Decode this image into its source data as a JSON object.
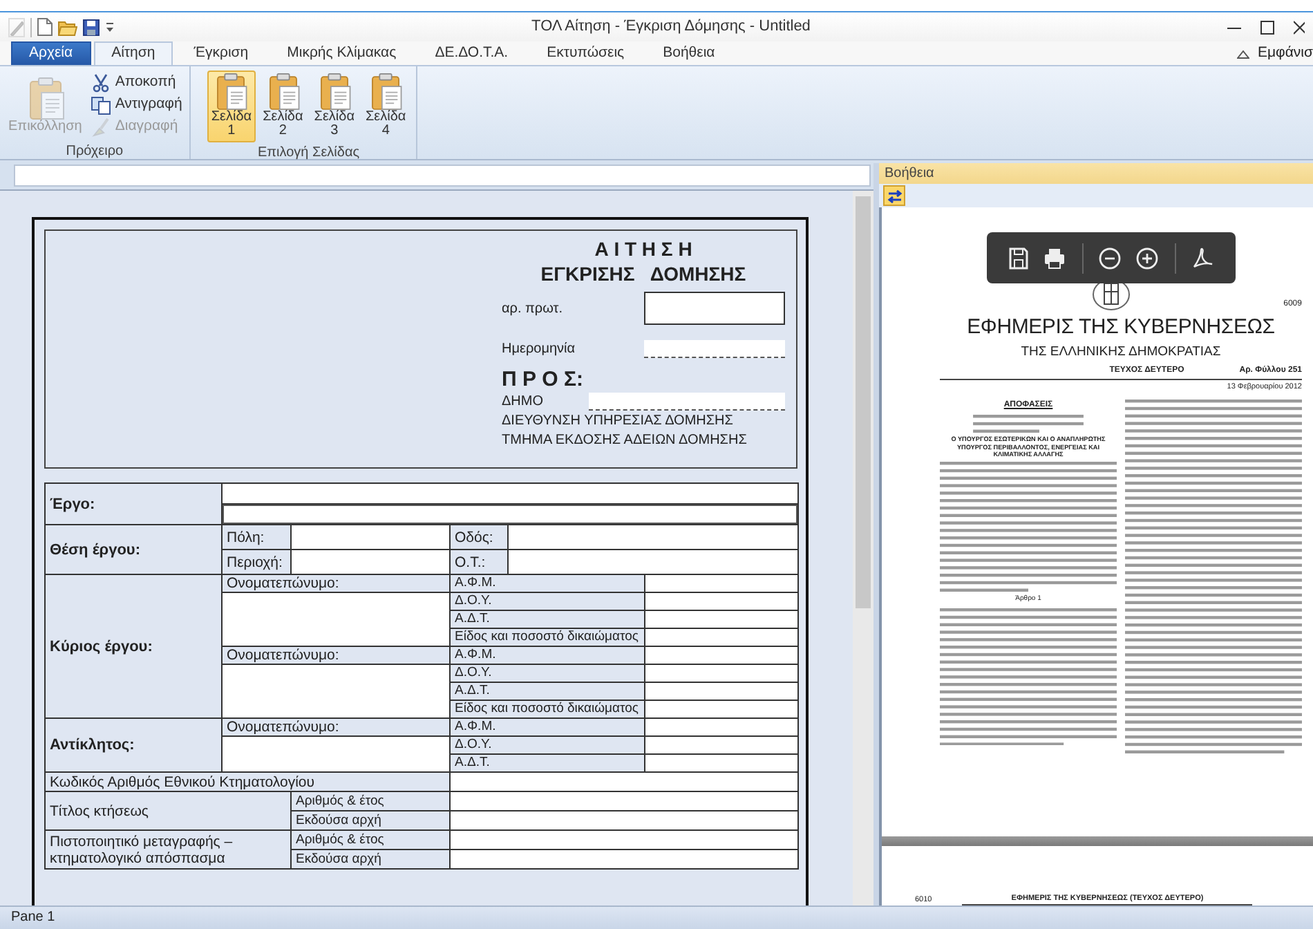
{
  "window": {
    "title": "ΤΟΛ Αίτηση - Έγκριση Δόμησης - Untitled"
  },
  "menu_tabs": [
    {
      "label": "Αρχεία",
      "kind": "file",
      "selected": false
    },
    {
      "label": "Αίτηση",
      "kind": "tab",
      "selected": true
    },
    {
      "label": "Έγκριση",
      "kind": "tab",
      "selected": false
    },
    {
      "label": "Μικρής Κλίμακας",
      "kind": "tab",
      "selected": false
    },
    {
      "label": "ΔΕ.ΔΟ.Τ.Α.",
      "kind": "tab",
      "selected": false
    },
    {
      "label": "Εκτυπώσεις",
      "kind": "tab",
      "selected": false
    },
    {
      "label": "Βοήθεια",
      "kind": "tab",
      "selected": false
    }
  ],
  "view_menu": {
    "label": "Εμφάνισ"
  },
  "ribbon_groups": [
    {
      "kind": "clipboard",
      "label": "Πρόχειρο",
      "large": {
        "label": "Επικόλληση",
        "disabled": true
      },
      "small": [
        {
          "kind": "cut",
          "label": "Αποκοπή",
          "disabled": false
        },
        {
          "kind": "copy",
          "label": "Αντιγραφή",
          "disabled": false
        },
        {
          "kind": "delete",
          "label": "Διαγραφή",
          "disabled": true
        }
      ]
    },
    {
      "kind": "pages",
      "label": "Επιλογή Σελίδας",
      "buttons": [
        {
          "label": "Σελίδα",
          "number": "1",
          "selected": true
        },
        {
          "label": "Σελίδα",
          "number": "2",
          "selected": false
        },
        {
          "label": "Σελίδα",
          "number": "3",
          "selected": false
        },
        {
          "label": "Σελίδα",
          "number": "4",
          "selected": false
        }
      ]
    }
  ],
  "form": {
    "header": {
      "title": "Α Ι Τ Η Σ Η",
      "subtitle": "ΕΓΚΡΙΣΗΣ   ΔΟΜΗΣΗΣ",
      "protocol_label": "αρ. πρωτ.",
      "date_label": "Ημερομηνία",
      "to_heading": "Π Ρ Ο Σ:",
      "municipality_label": "ΔΗΜΟ",
      "lines": [
        "ΔΙΕΥΘΥΝΣΗ ΥΠΗΡΕΣΙΑΣ ΔΟΜΗΣΗΣ",
        "ΤΜΗΜΑ ΕΚΔΟΣΗΣ ΑΔΕΙΩΝ ΔΟΜΗΣΗΣ"
      ]
    },
    "sections": [
      {
        "kind": "project",
        "label": "Έργο:"
      },
      {
        "kind": "location",
        "label": "Θέση έργου:",
        "fields": [
          "Πόλη:",
          "Οδός:",
          "Περιοχή:",
          "Ο.Τ.:"
        ]
      },
      {
        "kind": "persons",
        "label": "Κύριος έργου:",
        "persons": [
          {
            "name_label": "Ονοματεπώνυμο:",
            "fields": [
              "Α.Φ.Μ.",
              "Δ.Ο.Υ.",
              "Α.Δ.Τ.",
              "Είδος και ποσοστό δικαιώματος"
            ]
          },
          {
            "name_label": "Ονοματεπώνυμο:",
            "fields": [
              "Α.Φ.Μ.",
              "Δ.Ο.Υ.",
              "Α.Δ.Τ.",
              "Είδος και ποσοστό δικαιώματος"
            ]
          }
        ]
      },
      {
        "kind": "persons",
        "label": "Αντίκλητος:",
        "persons": [
          {
            "name_label": "Ονοματεπώνυμο:",
            "fields": [
              "Α.Φ.Μ.",
              "Δ.Ο.Υ.",
              "Α.Δ.Τ."
            ]
          }
        ]
      },
      {
        "kind": "single",
        "label": "Κωδικός Αριθμός Εθνικού Κτηματολογίου"
      },
      {
        "kind": "document",
        "label": "Τίτλος κτήσεως",
        "fields": [
          "Αριθμός & έτος",
          "Εκδούσα αρχή"
        ]
      },
      {
        "kind": "document",
        "label": "Πιστοποιητικό μεταγραφής – κτηματολογικό απόσπασμα",
        "fields": [
          "Αριθμός & έτος",
          "Εκδούσα αρχή"
        ]
      }
    ]
  },
  "help_pane": {
    "title": "Βοήθεια",
    "document": {
      "page_number": "6009",
      "masthead": "ΕΦΗΜΕΡΙΣ ΤΗΣ ΚΥΒΕΡΝΗΣΕΩΣ",
      "subtitle": "ΤΗΣ ΕΛΛΗΝΙΚΗΣ ΔΗΜΟΚΡΑΤΙΑΣ",
      "issue": "ΤΕΥΧΟΣ ΔΕΥΤΕΡΟ",
      "sheet": "Αρ. Φύλλου 251",
      "date": "13 Φεβρουαρίου 2012",
      "section": "ΑΠΟΦΑΣΕΙΣ",
      "heading": "Ο ΥΠΟΥΡΓΟΣ ΕΣΩΤΕΡΙΚΩΝ ΚΑΙ Ο ΑΝΑΠΛΗΡΩΤΗΣ ΥΠΟΥΡΓΟΣ ΠΕΡΙΒΑΛΛΟΝΤΟΣ, ΕΝΕΡΓΕΙΑΣ ΚΑΙ ΚΛΙΜΑΤΙΚΗΣ ΑΛΛΑΓΗΣ",
      "article": "Άρθρο 1",
      "next_page_number": "6010",
      "next_page_header": "ΕΦΗΜΕΡΙΣ ΤΗΣ ΚΥΒΕΡΝΗΣΕΩΣ (ΤΕΥΧΟΣ ΔΕΥΤΕΡΟ)"
    }
  },
  "status_bar": {
    "text": "Pane 1"
  }
}
